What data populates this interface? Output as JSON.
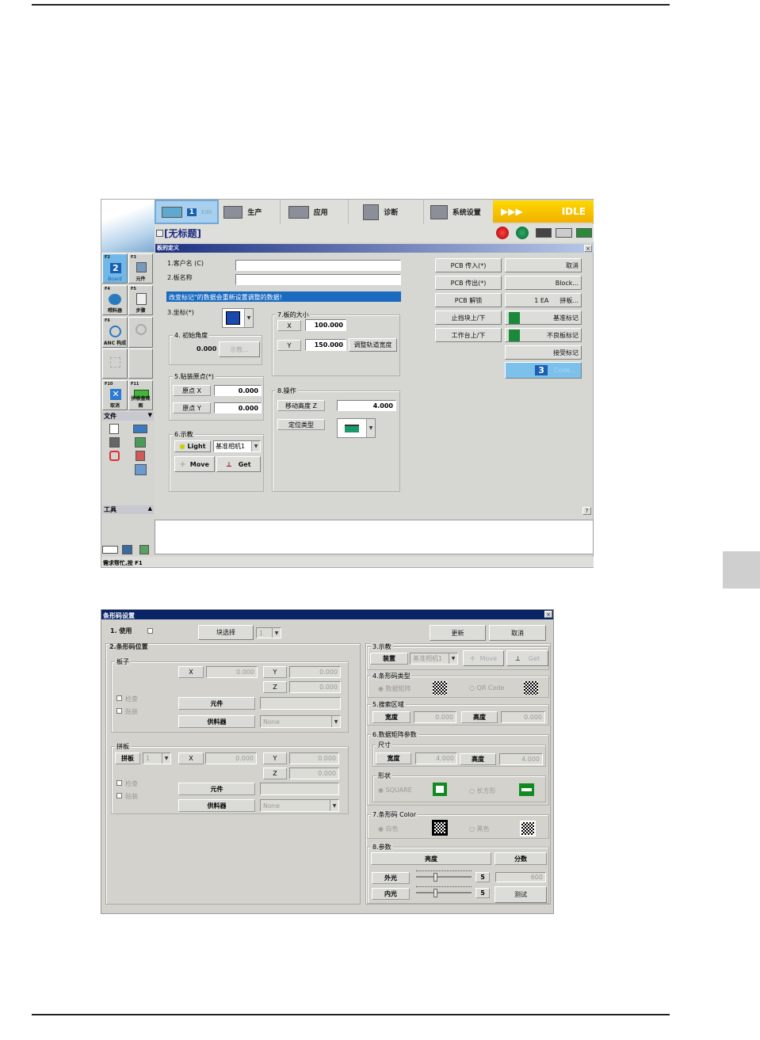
{
  "screen1": {
    "toolbar": {
      "tabs": [
        {
          "num": "1",
          "label": "Edit"
        },
        {
          "label": "生产"
        },
        {
          "label": "应用"
        },
        {
          "label": "诊断"
        },
        {
          "label": "系统设置"
        }
      ],
      "status": "IDLE",
      "status_arrows": "▶▶▶",
      "status_color": "#f5c400"
    },
    "doc_title": "[无标题]",
    "sidebar": {
      "fkeys": [
        {
          "key": "F2",
          "num": "2",
          "label": "Board"
        },
        {
          "key": "F3",
          "label": "元件"
        },
        {
          "key": "F4",
          "label": "喂料器"
        },
        {
          "key": "F5",
          "label": "步骤"
        },
        {
          "key": "F6",
          "label": "ANC 构成"
        },
        {
          "key": "F10",
          "label": "取消"
        },
        {
          "key": "F11",
          "label": "拼板直观图"
        }
      ],
      "file_header": "文件",
      "tools_header": "工具"
    },
    "panel": {
      "title": "板的定义",
      "close": "×",
      "help": "?",
      "customer_label": "1.客户名 (C)",
      "customer_value": "",
      "board_name_label": "2.板名称",
      "board_name_value": "",
      "notice": "改变标记\"的数据会重新设置调整的数据!",
      "coord_label": "3.坐标(*)",
      "angle": {
        "title": "4. 初始角度",
        "value": "0.000",
        "teach": "示教..."
      },
      "size": {
        "title": "7.板的大小",
        "x_label": "X",
        "x_value": "100.000",
        "y_label": "Y",
        "y_value": "150.000",
        "adjust": "调整轨道宽度"
      },
      "origin": {
        "title": "5.贴装原点(*)",
        "x_label": "原点 X",
        "x_value": "0.000",
        "y_label": "原点 Y",
        "y_value": "0.000"
      },
      "teach": {
        "title": "6.示教",
        "light": "Light",
        "camera": "基准相机1",
        "move": "Move",
        "get": "Get"
      },
      "operation": {
        "title": "8.操作",
        "z_label": "移动高度 Z",
        "z_value": "4.000",
        "locate_label": "定位类型"
      },
      "buttons_left": [
        "PCB 传入(*)",
        "PCB 传出(*)",
        "PCB 解锁",
        "止挡块上/下",
        "工作台上/下"
      ],
      "buttons_right": {
        "cancel": "取消",
        "block": "Block...",
        "count": "1 EA",
        "array": "拼板...",
        "fiducial": "基准标记",
        "bad": "不良板标记",
        "accept": "接受标记",
        "code_num": "3",
        "code": "Code..."
      }
    },
    "statusbar": "需求帮忙,按 F1"
  },
  "screen2": {
    "title": "条形码设置",
    "close": "×",
    "use_label": "1. 使用",
    "block_select": "块选择",
    "block_value": "1",
    "update": "更新",
    "cancel": "取消",
    "position": {
      "title": "2.条形码位置",
      "board": {
        "title": "板子",
        "x": "X",
        "x_value": "0.000",
        "y": "Y",
        "y_value": "0.000",
        "z": "Z",
        "z_value": "0.000",
        "check": "检查",
        "mount": "贴装",
        "part": "元件",
        "part_value": "",
        "feeder": "供料器",
        "feeder_value": "None"
      },
      "array": {
        "title": "拼板",
        "array_label": "拼板",
        "array_value": "1",
        "x": "X",
        "x_value": "0.000",
        "y": "Y",
        "y_value": "0.000",
        "z": "Z",
        "z_value": "0.000",
        "check": "检查",
        "mount": "贴装",
        "part": "元件",
        "part_value": "",
        "feeder": "供料器",
        "feeder_value": "None"
      }
    },
    "teach": {
      "title": "3.示教",
      "device": "装置",
      "camera": "基准相机1",
      "move": "Move",
      "get": "Get"
    },
    "type": {
      "title": "4.条形码类型",
      "opt1": "数据矩阵",
      "opt2": "QR Code"
    },
    "search": {
      "title": "5.搜索区域",
      "width": "宽度",
      "width_value": "0.000",
      "height": "高度",
      "height_value": "0.000"
    },
    "matrix": {
      "title": "6.数据矩阵参数",
      "size_title": "尺寸",
      "width": "宽度",
      "width_value": "4.000",
      "height": "高度",
      "height_value": "4.000",
      "shape_title": "形状",
      "shape1": "SQUARE",
      "shape2": "长方形"
    },
    "color": {
      "title": "7.条形码 Color",
      "opt1": "白色",
      "opt2": "黑色"
    },
    "params": {
      "title": "8.参数",
      "brightness": "亮度",
      "score": "分数",
      "outer": "外光",
      "outer_value": "5",
      "inner": "内光",
      "inner_value": "5",
      "score_value": "600",
      "test": "测试"
    }
  }
}
